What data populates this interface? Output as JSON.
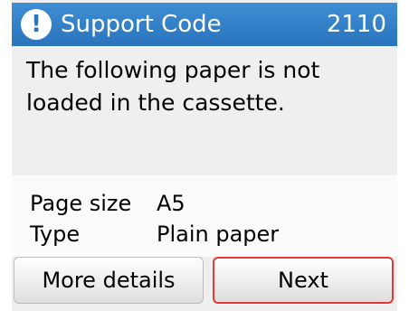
{
  "header": {
    "title": "Support Code",
    "code": "2110",
    "icon": "warning-icon",
    "color": "#2a74bd"
  },
  "message": "The following paper is not loaded in the cassette.",
  "info": {
    "rows": [
      {
        "label": "Page size",
        "value": "A5"
      },
      {
        "label": "Type",
        "value": "Plain paper"
      }
    ]
  },
  "buttons": {
    "more_details": "More details",
    "next": "Next",
    "next_highlight_color": "#e53935"
  }
}
